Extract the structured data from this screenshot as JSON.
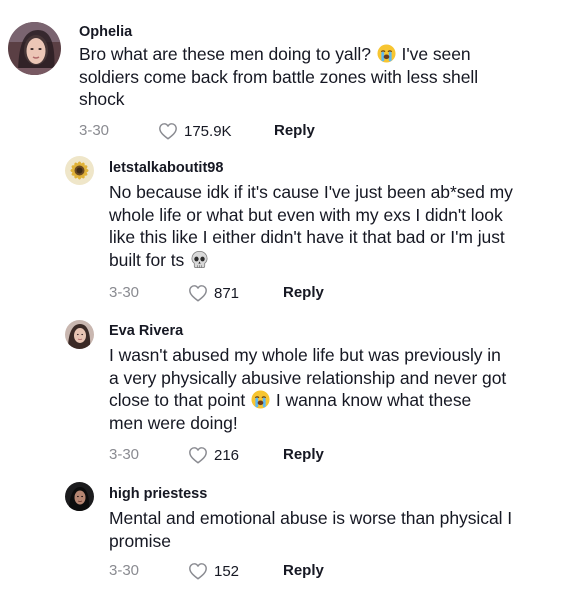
{
  "comments": [
    {
      "username": "Ophelia",
      "lines": [
        "Bro what are these men doing to yall?",
        " I've seen",
        "soldiers come back from battle zones with less shell",
        "shock"
      ],
      "date": "3-30",
      "likes": "175.9K",
      "reply_label": "Reply",
      "avatar_icon": "profile-photo-woman"
    },
    {
      "username": "letstalkaboutit98",
      "lines": [
        "No because idk if it's cause I've just been ab*sed my",
        "whole life or what but even with my exs I didn't look",
        "like this like I either didn't have it that bad or I'm just",
        "built for ts"
      ],
      "date": "3-30",
      "likes": "871",
      "reply_label": "Reply",
      "avatar_icon": "flower-avatar"
    },
    {
      "username": "Eva Rivera",
      "lines": [
        "I wasn't abused my whole life but was previously in",
        "a very physically abusive relationship and never got",
        "close to that point",
        " I wanna know what these",
        "men were doing!"
      ],
      "date": "3-30",
      "likes": "216",
      "reply_label": "Reply",
      "avatar_icon": "profile-photo-woman"
    },
    {
      "username": "high priestess",
      "lines": [
        "Mental and emotional abuse is worse than physical I",
        "promise"
      ],
      "date": "3-30",
      "likes": "152",
      "reply_label": "Reply",
      "avatar_icon": "profile-photo-dark"
    }
  ],
  "emojis": {
    "crying": "loudly-crying-face-emoji",
    "skull": "skull-emoji"
  },
  "colors": {
    "text": "#161823",
    "muted": "#8a8b91",
    "background": "#ffffff"
  }
}
